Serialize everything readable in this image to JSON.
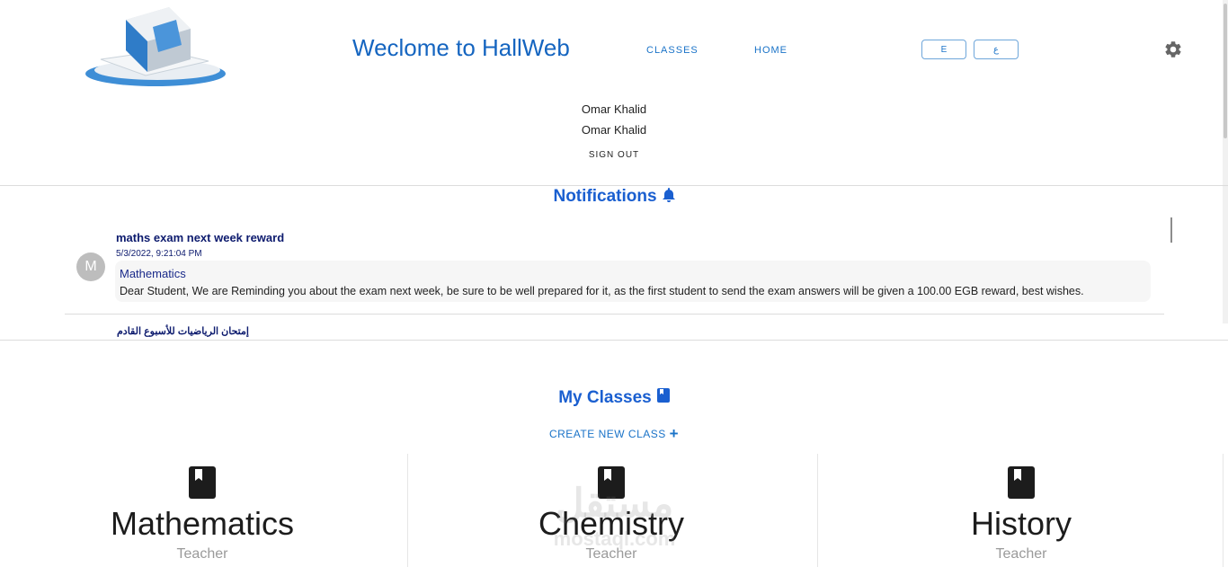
{
  "header": {
    "title": "Weclome to HallWeb",
    "nav": {
      "classes": "CLASSES",
      "home": "HOME"
    },
    "lang": {
      "en": "E",
      "ar": "ع"
    },
    "user": {
      "name_line_1": "Omar Khalid",
      "name_line_2": "Omar Khalid",
      "sign_out": "SIGN OUT"
    }
  },
  "notifications": {
    "title": "Notifications",
    "items": [
      {
        "title": "maths exam next week reward",
        "date": "5/3/2022, 9:21:04 PM",
        "avatar_letter": "M",
        "subject": "Mathematics",
        "message": "Dear Student, We are Reminding you about the exam next week, be sure to be well prepared for it, as the first student to send the exam answers will be given a 100.00 EGB reward, best wishes."
      },
      {
        "title": "إمتحان الرياضيات للأسبوع القادم"
      }
    ]
  },
  "classes": {
    "title": "My Classes",
    "create_label": "CREATE NEW CLASS",
    "create_icon": "+",
    "items": [
      {
        "name": "Mathematics",
        "teacher": "Teacher"
      },
      {
        "name": "Chemistry",
        "teacher": "Teacher"
      },
      {
        "name": "History",
        "teacher": "Teacher"
      }
    ]
  },
  "watermark": {
    "arabic": "مستقل",
    "latin": "mostaql.com"
  },
  "colors": {
    "accent": "#1a5fd0",
    "link": "#1a73c8",
    "dark_navy": "#0d1b6e"
  }
}
